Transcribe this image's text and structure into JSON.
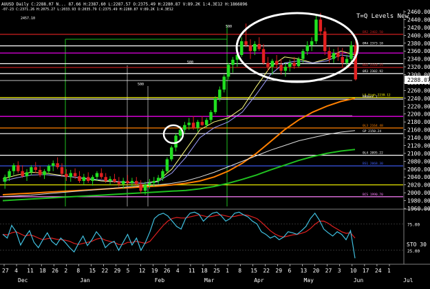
{
  "header": {
    "line1": "AUUSD Daily C:2288.07 N... 87.66 H:2387.60 L:2287.57 O:2375.49 H:2280.87 V:89.2K 1:4.3E12 H:1866896",
    "line2": "-07-23  C:2371.26  H:2075.27  L:2033.93  O:2035.79  C:2375.49  H:2280.87  V:89.2K  1:4.3E12"
  },
  "title_text": "T=Q Levels New",
  "price_axis": {
    "min": 1960,
    "max": 2460,
    "tick_step": 20,
    "ticks": [
      "2460.00",
      "2440.00",
      "2420.00",
      "2400.00",
      "2380.00",
      "2360.00",
      "2340.00",
      "2320.00",
      "2300.00",
      "2280.00",
      "2260.00",
      "2240.00",
      "2220.00",
      "2200.00",
      "2180.00",
      "2160.00",
      "2140.00",
      "2120.00",
      "2100.00",
      "2080.00",
      "2060.00",
      "2040.00",
      "2020.00",
      "2000.00",
      "1980.00",
      "1960.00"
    ],
    "last_price_label": "2288.07",
    "last_price": 2288.07
  },
  "osc_axis": {
    "min": 0,
    "max": 100,
    "label": "STO  30",
    "ticks": [
      "75.00",
      "25.00"
    ],
    "tick_values": [
      75,
      25
    ]
  },
  "x_axis": {
    "day_labels": [
      "27",
      "4",
      "11",
      "18",
      "26",
      "2",
      "8",
      "15",
      "22",
      "29",
      "5",
      "12",
      "19",
      "26",
      "4",
      "11",
      "18",
      "25",
      "1",
      "8",
      "15",
      "22",
      "29",
      "6",
      "13",
      "20",
      "27",
      "3",
      "10",
      "17",
      "24",
      "1"
    ],
    "month_labels": [
      "Dec",
      "Jan",
      "Feb",
      "Mar",
      "Apr",
      "May",
      "Jun",
      "Jul"
    ]
  },
  "chart_data": {
    "type": "candlestick",
    "symbol": "AUUSD",
    "timeframe": "Daily",
    "last_close": 2288.07,
    "ylim": [
      1960,
      2460
    ],
    "grid": false,
    "levels": [
      {
        "value": 2402.5,
        "label": "BR2 2402.50",
        "color": "#d02020"
      },
      {
        "value": 2373.18,
        "label": "0R4 2373.18",
        "color": "#ffffff"
      },
      {
        "value": 2355,
        "label": "",
        "color": "#ff00ff"
      },
      {
        "value": 2328,
        "label": "",
        "color": "#ffffff"
      },
      {
        "value": 2318.25,
        "label": "BEE 2318.25",
        "color": "#d02020"
      },
      {
        "value": 2302.92,
        "label": "0R3 2302.92",
        "color": "#ffffff"
      },
      {
        "value": 2242,
        "label": "LS High 2239.12",
        "color": "#ffff00"
      },
      {
        "value": 2238,
        "label": "BR0mer 1",
        "color": "#ffffff"
      },
      {
        "value": 2194,
        "label": "",
        "color": "#ff00ff"
      },
      {
        "value": 2164.48,
        "label": "0L3 2164.48",
        "color": "#ff8000"
      },
      {
        "value": 2150.24,
        "label": "GP 2150.24",
        "color": "#ffffff"
      },
      {
        "value": 2095.22,
        "label": "0L4 2095.22",
        "color": "#ffffff"
      },
      {
        "value": 2068.3,
        "label": "BS1 2068.30",
        "color": "#4060ff"
      },
      {
        "value": 2020,
        "label": "",
        "color": "#ffff00"
      },
      {
        "value": 1990,
        "label": "BCS 1990.70",
        "color": "#ff80ff"
      }
    ],
    "annotations": [
      "2457.10",
      "500",
      "500",
      "500"
    ],
    "candles": [
      {
        "o": 2028,
        "h": 2046,
        "l": 2010,
        "c": 2040
      },
      {
        "o": 2040,
        "h": 2060,
        "l": 2030,
        "c": 2055
      },
      {
        "o": 2055,
        "h": 2075,
        "l": 2045,
        "c": 2070
      },
      {
        "o": 2070,
        "h": 2080,
        "l": 2050,
        "c": 2055
      },
      {
        "o": 2055,
        "h": 2070,
        "l": 2038,
        "c": 2042
      },
      {
        "o": 2042,
        "h": 2060,
        "l": 2030,
        "c": 2052
      },
      {
        "o": 2052,
        "h": 2070,
        "l": 2045,
        "c": 2065
      },
      {
        "o": 2065,
        "h": 2078,
        "l": 2050,
        "c": 2058
      },
      {
        "o": 2058,
        "h": 2068,
        "l": 2040,
        "c": 2045
      },
      {
        "o": 2045,
        "h": 2060,
        "l": 2035,
        "c": 2055
      },
      {
        "o": 2055,
        "h": 2072,
        "l": 2048,
        "c": 2068
      },
      {
        "o": 2068,
        "h": 2082,
        "l": 2055,
        "c": 2075
      },
      {
        "o": 2075,
        "h": 2090,
        "l": 2060,
        "c": 2065
      },
      {
        "o": 2065,
        "h": 2075,
        "l": 2040,
        "c": 2048
      },
      {
        "o": 2048,
        "h": 2060,
        "l": 2030,
        "c": 2040
      },
      {
        "o": 2040,
        "h": 2058,
        "l": 2028,
        "c": 2050
      },
      {
        "o": 2050,
        "h": 2062,
        "l": 2035,
        "c": 2042
      },
      {
        "o": 2042,
        "h": 2055,
        "l": 2025,
        "c": 2030
      },
      {
        "o": 2030,
        "h": 2048,
        "l": 2020,
        "c": 2040
      },
      {
        "o": 2040,
        "h": 2052,
        "l": 2025,
        "c": 2030
      },
      {
        "o": 2030,
        "h": 2045,
        "l": 2018,
        "c": 2040
      },
      {
        "o": 2040,
        "h": 2055,
        "l": 2030,
        "c": 2050
      },
      {
        "o": 2050,
        "h": 2062,
        "l": 2035,
        "c": 2040
      },
      {
        "o": 2040,
        "h": 2050,
        "l": 2025,
        "c": 2030
      },
      {
        "o": 2030,
        "h": 2042,
        "l": 2020,
        "c": 2035
      },
      {
        "o": 2035,
        "h": 2048,
        "l": 2025,
        "c": 2028
      },
      {
        "o": 2028,
        "h": 2040,
        "l": 2015,
        "c": 2022
      },
      {
        "o": 2022,
        "h": 2038,
        "l": 2010,
        "c": 2030
      },
      {
        "o": 2030,
        "h": 2045,
        "l": 2020,
        "c": 2025
      },
      {
        "o": 2025,
        "h": 2038,
        "l": 2015,
        "c": 2030
      },
      {
        "o": 2030,
        "h": 2040,
        "l": 2018,
        "c": 2022
      },
      {
        "o": 2022,
        "h": 2032,
        "l": 1998,
        "c": 2005
      },
      {
        "o": 2005,
        "h": 2028,
        "l": 1995,
        "c": 2020
      },
      {
        "o": 2020,
        "h": 2035,
        "l": 2010,
        "c": 2025
      },
      {
        "o": 2025,
        "h": 2040,
        "l": 2015,
        "c": 2030
      },
      {
        "o": 2030,
        "h": 2045,
        "l": 2022,
        "c": 2038
      },
      {
        "o": 2038,
        "h": 2060,
        "l": 2030,
        "c": 2055
      },
      {
        "o": 2055,
        "h": 2090,
        "l": 2050,
        "c": 2085
      },
      {
        "o": 2085,
        "h": 2120,
        "l": 2080,
        "c": 2115
      },
      {
        "o": 2115,
        "h": 2150,
        "l": 2105,
        "c": 2145
      },
      {
        "o": 2145,
        "h": 2170,
        "l": 2135,
        "c": 2160
      },
      {
        "o": 2160,
        "h": 2180,
        "l": 2150,
        "c": 2172
      },
      {
        "o": 2172,
        "h": 2190,
        "l": 2160,
        "c": 2178
      },
      {
        "o": 2178,
        "h": 2195,
        "l": 2160,
        "c": 2165
      },
      {
        "o": 2165,
        "h": 2185,
        "l": 2155,
        "c": 2180
      },
      {
        "o": 2180,
        "h": 2195,
        "l": 2170,
        "c": 2172
      },
      {
        "o": 2172,
        "h": 2190,
        "l": 2165,
        "c": 2185
      },
      {
        "o": 2185,
        "h": 2210,
        "l": 2178,
        "c": 2205
      },
      {
        "o": 2205,
        "h": 2245,
        "l": 2200,
        "c": 2240
      },
      {
        "o": 2240,
        "h": 2270,
        "l": 2232,
        "c": 2262
      },
      {
        "o": 2262,
        "h": 2300,
        "l": 2255,
        "c": 2295
      },
      {
        "o": 2295,
        "h": 2330,
        "l": 2288,
        "c": 2325
      },
      {
        "o": 2325,
        "h": 2345,
        "l": 2305,
        "c": 2338
      },
      {
        "o": 2338,
        "h": 2360,
        "l": 2320,
        "c": 2350
      },
      {
        "o": 2350,
        "h": 2395,
        "l": 2345,
        "c": 2385
      },
      {
        "o": 2385,
        "h": 2430,
        "l": 2370,
        "c": 2375
      },
      {
        "o": 2375,
        "h": 2390,
        "l": 2340,
        "c": 2360
      },
      {
        "o": 2360,
        "h": 2385,
        "l": 2350,
        "c": 2378
      },
      {
        "o": 2378,
        "h": 2395,
        "l": 2360,
        "c": 2365
      },
      {
        "o": 2365,
        "h": 2378,
        "l": 2325,
        "c": 2330
      },
      {
        "o": 2330,
        "h": 2345,
        "l": 2310,
        "c": 2320
      },
      {
        "o": 2320,
        "h": 2340,
        "l": 2300,
        "c": 2335
      },
      {
        "o": 2335,
        "h": 2350,
        "l": 2315,
        "c": 2325
      },
      {
        "o": 2325,
        "h": 2340,
        "l": 2300,
        "c": 2310
      },
      {
        "o": 2310,
        "h": 2330,
        "l": 2295,
        "c": 2320
      },
      {
        "o": 2320,
        "h": 2338,
        "l": 2308,
        "c": 2330
      },
      {
        "o": 2330,
        "h": 2345,
        "l": 2315,
        "c": 2322
      },
      {
        "o": 2322,
        "h": 2345,
        "l": 2318,
        "c": 2340
      },
      {
        "o": 2340,
        "h": 2365,
        "l": 2330,
        "c": 2360
      },
      {
        "o": 2360,
        "h": 2385,
        "l": 2350,
        "c": 2375
      },
      {
        "o": 2375,
        "h": 2395,
        "l": 2360,
        "c": 2385
      },
      {
        "o": 2385,
        "h": 2450,
        "l": 2378,
        "c": 2440
      },
      {
        "o": 2440,
        "h": 2457,
        "l": 2400,
        "c": 2410
      },
      {
        "o": 2410,
        "h": 2420,
        "l": 2350,
        "c": 2360
      },
      {
        "o": 2360,
        "h": 2370,
        "l": 2330,
        "c": 2340
      },
      {
        "o": 2340,
        "h": 2365,
        "l": 2330,
        "c": 2355
      },
      {
        "o": 2355,
        "h": 2370,
        "l": 2335,
        "c": 2345
      },
      {
        "o": 2345,
        "h": 2368,
        "l": 2320,
        "c": 2330
      },
      {
        "o": 2330,
        "h": 2350,
        "l": 2315,
        "c": 2340
      },
      {
        "o": 2340,
        "h": 2385,
        "l": 2330,
        "c": 2375
      },
      {
        "o": 2375,
        "h": 2388,
        "l": 2285,
        "c": 2288
      }
    ],
    "moving_averages": [
      {
        "color": "#ff8000",
        "values": [
          1995,
          1997,
          1999,
          2001,
          2003,
          2005,
          2007,
          2009,
          2011,
          2013,
          2015,
          2017,
          2020,
          2024,
          2030,
          2040,
          2055,
          2075,
          2100,
          2130,
          2160,
          2185,
          2205,
          2220,
          2232,
          2240
        ]
      },
      {
        "color": "#20c020",
        "values": [
          1980,
          1982,
          1984,
          1986,
          1988,
          1990,
          1992,
          1994,
          1996,
          1998,
          2000,
          2002,
          2004,
          2006,
          2010,
          2016,
          2024,
          2034,
          2045,
          2058,
          2070,
          2082,
          2092,
          2100,
          2106,
          2110
        ]
      },
      {
        "color": "#e0e0e0",
        "values": [
          1990,
          1992,
          1994,
          1997,
          2000,
          2003,
          2006,
          2009,
          2012,
          2015,
          2018,
          2020,
          2024,
          2030,
          2040,
          2052,
          2066,
          2080,
          2094,
          2108,
          2120,
          2132,
          2140,
          2148,
          2154,
          2158
        ]
      },
      {
        "color": "#ffff80",
        "values": [
          2035,
          2045,
          2052,
          2050,
          2045,
          2040,
          2035,
          2030,
          2028,
          2025,
          2024,
          2030,
          2060,
          2110,
          2160,
          2180,
          2190,
          2215,
          2270,
          2320,
          2345,
          2340,
          2330,
          2340,
          2360,
          2350
        ]
      },
      {
        "color": "#a0a0ff",
        "values": [
          2030,
          2038,
          2045,
          2046,
          2043,
          2040,
          2036,
          2032,
          2029,
          2026,
          2024,
          2028,
          2050,
          2090,
          2140,
          2165,
          2180,
          2205,
          2250,
          2300,
          2330,
          2335,
          2330,
          2335,
          2350,
          2345
        ]
      }
    ],
    "oscillator": {
      "name": "STO",
      "period": 30,
      "k": [
        55,
        48,
        72,
        60,
        35,
        50,
        62,
        40,
        30,
        45,
        58,
        42,
        35,
        48,
        40,
        30,
        22,
        38,
        52,
        34,
        45,
        60,
        50,
        30,
        38,
        42,
        25,
        40,
        55,
        35,
        48,
        25,
        40,
        60,
        85,
        92,
        95,
        90,
        80,
        70,
        65,
        85,
        95,
        97,
        93,
        80,
        88,
        95,
        97,
        90,
        80,
        85,
        95,
        97,
        92,
        88,
        80,
        75,
        60,
        55,
        48,
        52,
        45,
        50,
        60,
        58,
        55,
        62,
        70,
        85,
        95,
        82,
        65,
        58,
        52,
        60,
        55,
        45,
        62,
        10
      ],
      "d": [
        55,
        54,
        58,
        60,
        56,
        52,
        54,
        52,
        48,
        45,
        47,
        48,
        46,
        45,
        44,
        42,
        38,
        36,
        38,
        40,
        42,
        46,
        48,
        44,
        42,
        40,
        36,
        36,
        40,
        40,
        42,
        40,
        38,
        42,
        52,
        62,
        72,
        80,
        85,
        87,
        86,
        86,
        88,
        90,
        92,
        90,
        88,
        89,
        91,
        92,
        90,
        88,
        89,
        91,
        92,
        91,
        88,
        85,
        78,
        70,
        62,
        56,
        52,
        50,
        52,
        54,
        55,
        57,
        60,
        66,
        74,
        80,
        80,
        76,
        70,
        65,
        60,
        57,
        58,
        48
      ]
    }
  }
}
